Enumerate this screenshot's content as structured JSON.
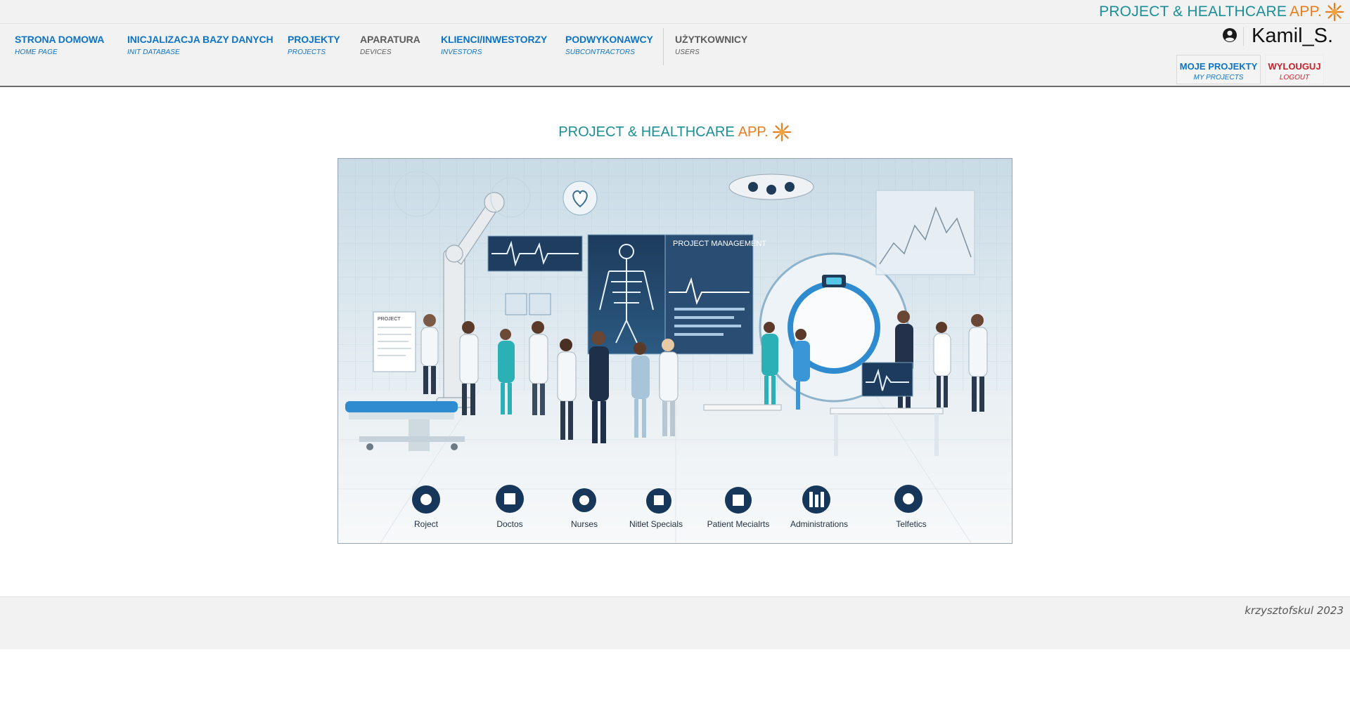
{
  "brand": {
    "main": "PROJECT & HEALTHCARE",
    "accent": "APP.",
    "logo_icon": "sun-icon",
    "color_main": "#1b8f95",
    "color_accent": "#e87d1e"
  },
  "nav": {
    "items": [
      {
        "label": "STRONA DOMOWA",
        "sub": "HOME PAGE"
      },
      {
        "label": "INICJALIZACJA BAZY DANYCH",
        "sub": "INIT DATABASE"
      },
      {
        "label": "PROJEKTY",
        "sub": "PROJECTS"
      },
      {
        "label": "APARATURA",
        "sub": "DEVICES"
      },
      {
        "label": "KLIENCI/INWESTORZY",
        "sub": "INVESTORS"
      },
      {
        "label": "PODWYKONAWCY",
        "sub": "SUBCONTRACTORS"
      },
      {
        "label": "UŻYTKOWNICY",
        "sub": "USERS"
      }
    ],
    "link_color": "#0d73c7",
    "muted_color": "#5c5c5c"
  },
  "user": {
    "icon": "user-circle-icon",
    "name": "Kamil_S.",
    "my_projects": {
      "label": "MOJE PROJEKTY",
      "sub": "MY PROJECTS"
    },
    "logout": {
      "label": "WYLOUGUJ",
      "sub": "LOGOUT",
      "color": "#c8232c"
    }
  },
  "hero": {
    "title_main": "PROJECT & HEALTHCARE",
    "title_accent": "APP.",
    "image": {
      "screen_label": "PROJECT MANAGEMENT",
      "document_label": "PROJECT",
      "categories": [
        "Roject",
        "Doctos",
        "Nurses",
        "Nitlet Specials",
        "Patient Mecialrts",
        "Administrations",
        "Telfetics"
      ]
    }
  },
  "footer": {
    "text": "krzysztofskul 2023"
  }
}
